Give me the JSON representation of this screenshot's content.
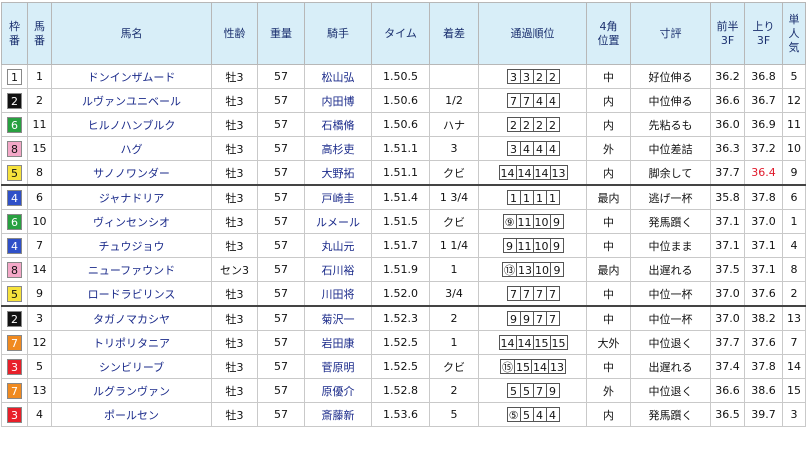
{
  "headers": {
    "waku": [
      "枠",
      "番"
    ],
    "umaban": [
      "馬",
      "番"
    ],
    "name": "馬名",
    "sex_age": "性齢",
    "weight": "重量",
    "jockey": "騎手",
    "time": "タイム",
    "margin": "着差",
    "passing": "通過順位",
    "corner": [
      "4角",
      "位置"
    ],
    "comment": "寸評",
    "first3f": [
      "前半",
      "3F"
    ],
    "last3f": [
      "上り",
      "3F"
    ],
    "popularity": [
      "単",
      "人",
      "気"
    ]
  },
  "colors": {
    "1": {
      "bg": "#ffffff",
      "fg": "#111111"
    },
    "2": {
      "bg": "#111111",
      "fg": "#ffffff"
    },
    "3": {
      "bg": "#e8202a",
      "fg": "#ffffff"
    },
    "4": {
      "bg": "#2f50c8",
      "fg": "#ffffff"
    },
    "5": {
      "bg": "#f6e23c",
      "fg": "#111111"
    },
    "6": {
      "bg": "#28a040",
      "fg": "#ffffff"
    },
    "7": {
      "bg": "#f08a20",
      "fg": "#ffffff"
    },
    "8": {
      "bg": "#f4a8c8",
      "fg": "#111111"
    },
    "last3f_highlight": "#e0182a"
  },
  "rows": [
    {
      "waku": "1",
      "umaban": "1",
      "name": "ドンインザムード",
      "sex_age": "牡3",
      "weight": "57",
      "jockey": "松山弘",
      "time": "1.50.5",
      "margin": "",
      "passing": [
        "3",
        "3",
        "2",
        "2"
      ],
      "corner": "中",
      "comment": "好位伸る",
      "first3f": "36.2",
      "last3f": "36.8",
      "last3f_highlight": false,
      "popularity": "5"
    },
    {
      "waku": "2",
      "umaban": "2",
      "name": "ルヴァンユニベール",
      "sex_age": "牡3",
      "weight": "57",
      "jockey": "内田博",
      "time": "1.50.6",
      "margin": "1/2",
      "passing": [
        "7",
        "7",
        "4",
        "4"
      ],
      "corner": "内",
      "comment": "中位伸る",
      "first3f": "36.6",
      "last3f": "36.7",
      "last3f_highlight": false,
      "popularity": "12"
    },
    {
      "waku": "6",
      "umaban": "11",
      "name": "ヒルノハンブルク",
      "sex_age": "牡3",
      "weight": "57",
      "jockey": "石橋脩",
      "time": "1.50.6",
      "margin": "ハナ",
      "passing": [
        "2",
        "2",
        "2",
        "2"
      ],
      "corner": "内",
      "comment": "先粘るも",
      "first3f": "36.0",
      "last3f": "36.9",
      "last3f_highlight": false,
      "popularity": "11"
    },
    {
      "waku": "8",
      "umaban": "15",
      "name": "ハグ",
      "sex_age": "牡3",
      "weight": "57",
      "jockey": "高杉吏",
      "time": "1.51.1",
      "margin": "3",
      "passing": [
        "3",
        "4",
        "4",
        "4"
      ],
      "corner": "外",
      "comment": "中位差詰",
      "first3f": "36.3",
      "last3f": "37.2",
      "last3f_highlight": false,
      "popularity": "10"
    },
    {
      "waku": "5",
      "umaban": "8",
      "name": "サノノワンダー",
      "sex_age": "牡3",
      "weight": "57",
      "jockey": "大野拓",
      "time": "1.51.1",
      "margin": "クビ",
      "passing": [
        "14",
        "14",
        "14",
        "13"
      ],
      "corner": "内",
      "comment": "脚余して",
      "first3f": "37.7",
      "last3f": "36.4",
      "last3f_highlight": true,
      "popularity": "9"
    },
    {
      "waku": "4",
      "umaban": "6",
      "name": "ジャナドリア",
      "sex_age": "牡3",
      "weight": "57",
      "jockey": "戸崎圭",
      "time": "1.51.4",
      "margin": "1 3/4",
      "passing": [
        "1",
        "1",
        "1",
        "1"
      ],
      "corner": "最内",
      "comment": "逃げ一杯",
      "first3f": "35.8",
      "last3f": "37.8",
      "last3f_highlight": false,
      "popularity": "6"
    },
    {
      "waku": "6",
      "umaban": "10",
      "name": "ヴィンセンシオ",
      "sex_age": "牡3",
      "weight": "57",
      "jockey": "ルメール",
      "time": "1.51.5",
      "margin": "クビ",
      "passing": [
        "⑨",
        "11",
        "10",
        "9"
      ],
      "corner": "中",
      "comment": "発馬躓く",
      "first3f": "37.1",
      "last3f": "37.0",
      "last3f_highlight": false,
      "popularity": "1"
    },
    {
      "waku": "4",
      "umaban": "7",
      "name": "チュウジョウ",
      "sex_age": "牡3",
      "weight": "57",
      "jockey": "丸山元",
      "time": "1.51.7",
      "margin": "1 1/4",
      "passing": [
        "9",
        "11",
        "10",
        "9"
      ],
      "corner": "中",
      "comment": "中位まま",
      "first3f": "37.1",
      "last3f": "37.1",
      "last3f_highlight": false,
      "popularity": "4"
    },
    {
      "waku": "8",
      "umaban": "14",
      "name": "ニューファウンド",
      "sex_age": "セン3",
      "weight": "57",
      "jockey": "石川裕",
      "time": "1.51.9",
      "margin": "1",
      "passing": [
        "⑬",
        "13",
        "10",
        "9"
      ],
      "corner": "最内",
      "comment": "出遅れる",
      "first3f": "37.5",
      "last3f": "37.1",
      "last3f_highlight": false,
      "popularity": "8"
    },
    {
      "waku": "5",
      "umaban": "9",
      "name": "ロードラビリンス",
      "sex_age": "牡3",
      "weight": "57",
      "jockey": "川田将",
      "time": "1.52.0",
      "margin": "3/4",
      "passing": [
        "7",
        "7",
        "7",
        "7"
      ],
      "corner": "中",
      "comment": "中位一杯",
      "first3f": "37.0",
      "last3f": "37.6",
      "last3f_highlight": false,
      "popularity": "2"
    },
    {
      "waku": "2",
      "umaban": "3",
      "name": "タガノマカシヤ",
      "sex_age": "牡3",
      "weight": "57",
      "jockey": "菊沢一",
      "time": "1.52.3",
      "margin": "2",
      "passing": [
        "9",
        "9",
        "7",
        "7"
      ],
      "corner": "中",
      "comment": "中位一杯",
      "first3f": "37.0",
      "last3f": "38.2",
      "last3f_highlight": false,
      "popularity": "13"
    },
    {
      "waku": "7",
      "umaban": "12",
      "name": "トリポリタニア",
      "sex_age": "牡3",
      "weight": "57",
      "jockey": "岩田康",
      "time": "1.52.5",
      "margin": "1",
      "passing": [
        "14",
        "14",
        "15",
        "15"
      ],
      "corner": "大外",
      "comment": "中位退く",
      "first3f": "37.7",
      "last3f": "37.6",
      "last3f_highlight": false,
      "popularity": "7"
    },
    {
      "waku": "3",
      "umaban": "5",
      "name": "シンビリーブ",
      "sex_age": "牡3",
      "weight": "57",
      "jockey": "菅原明",
      "time": "1.52.5",
      "margin": "クビ",
      "passing": [
        "⑮",
        "15",
        "14",
        "13"
      ],
      "corner": "中",
      "comment": "出遅れる",
      "first3f": "37.4",
      "last3f": "37.8",
      "last3f_highlight": false,
      "popularity": "14"
    },
    {
      "waku": "7",
      "umaban": "13",
      "name": "ルグランヴァン",
      "sex_age": "牡3",
      "weight": "57",
      "jockey": "原優介",
      "time": "1.52.8",
      "margin": "2",
      "passing": [
        "5",
        "5",
        "7",
        "9"
      ],
      "corner": "外",
      "comment": "中位退く",
      "first3f": "36.6",
      "last3f": "38.6",
      "last3f_highlight": false,
      "popularity": "15"
    },
    {
      "waku": "3",
      "umaban": "4",
      "name": "ポールセン",
      "sex_age": "牡3",
      "weight": "57",
      "jockey": "斎藤新",
      "time": "1.53.6",
      "margin": "5",
      "passing": [
        "⑤",
        "5",
        "4",
        "4"
      ],
      "corner": "内",
      "comment": "発馬躓く",
      "first3f": "36.5",
      "last3f": "39.7",
      "last3f_highlight": false,
      "popularity": "3"
    }
  ]
}
